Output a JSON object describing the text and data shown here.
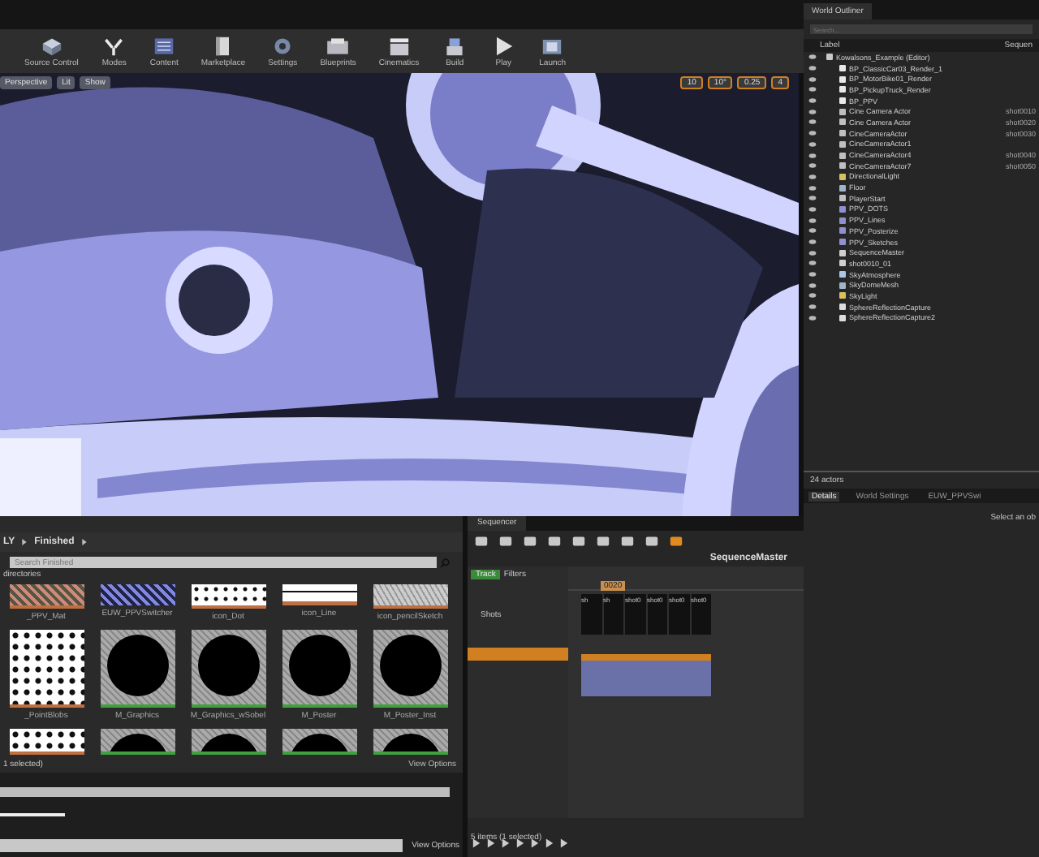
{
  "toolbar": [
    {
      "label": "Source Control",
      "kind": "cube"
    },
    {
      "label": "Modes",
      "kind": "modes"
    },
    {
      "label": "Content",
      "kind": "content"
    },
    {
      "label": "Marketplace",
      "kind": "market"
    },
    {
      "label": "Settings",
      "kind": "settings"
    },
    {
      "label": "Blueprints",
      "kind": "blueprint"
    },
    {
      "label": "Cinematics",
      "kind": "cinema"
    },
    {
      "label": "Build",
      "kind": "build"
    },
    {
      "label": "Play",
      "kind": "play"
    },
    {
      "label": "Launch",
      "kind": "launch"
    }
  ],
  "viewport": {
    "left_buttons": [
      "Perspective",
      "Lit",
      "Show"
    ],
    "right_values": [
      "10",
      "10°",
      "0.25",
      "4"
    ]
  },
  "outliner": {
    "tab": "World Outliner",
    "search": {
      "placeholder": "Search..."
    },
    "columns": [
      "Label",
      "Sequen"
    ],
    "root": {
      "label": "Kowalsons_Example (Editor)",
      "kind": "world",
      "children": [
        {
          "label": "BP_ClassicCar03_Render_1",
          "kind": "actor"
        },
        {
          "label": "BP_MotorBike01_Render",
          "kind": "actor"
        },
        {
          "label": "BP_PickupTruck_Render",
          "kind": "actor"
        },
        {
          "label": "BP_PPV",
          "kind": "actor"
        },
        {
          "label": "Cine Camera Actor",
          "kind": "camera",
          "sequence": "shot0010"
        },
        {
          "label": "Cine Camera Actor",
          "kind": "camera",
          "sequence": "shot0020"
        },
        {
          "label": "CineCameraActor",
          "kind": "camera",
          "sequence": "shot0030"
        },
        {
          "label": "CineCameraActor1",
          "kind": "camera"
        },
        {
          "label": "CineCameraActor4",
          "kind": "camera",
          "sequence": "shot0040"
        },
        {
          "label": "CineCameraActor7",
          "kind": "camera",
          "sequence": "shot0050"
        },
        {
          "label": "DirectionalLight",
          "kind": "light"
        },
        {
          "label": "Floor",
          "kind": "mesh"
        },
        {
          "label": "PlayerStart",
          "kind": "player"
        },
        {
          "label": "PPV_DOTS",
          "kind": "volume"
        },
        {
          "label": "PPV_Lines",
          "kind": "volume"
        },
        {
          "label": "PPV_Posterize",
          "kind": "volume"
        },
        {
          "label": "PPV_Sketches",
          "kind": "volume"
        },
        {
          "label": "SequenceMaster",
          "kind": "sequence"
        },
        {
          "label": "shot0010_01",
          "kind": "sequence"
        },
        {
          "label": "SkyAtmosphere",
          "kind": "sky"
        },
        {
          "label": "SkyDomeMesh",
          "kind": "mesh"
        },
        {
          "label": "SkyLight",
          "kind": "light"
        },
        {
          "label": "SphereReflectionCapture",
          "kind": "reflection"
        },
        {
          "label": "SphereReflectionCapture2",
          "kind": "reflection"
        }
      ]
    },
    "footer": "24 actors"
  },
  "details": {
    "tabs": [
      {
        "label": "Details",
        "selected": true
      },
      {
        "label": "World Settings",
        "selected": false
      },
      {
        "label": "EUW_PPVSwi",
        "selected": false
      }
    ],
    "hint": "Select an ob"
  },
  "content_browser": {
    "breadcrumb": [
      "LY",
      "Finished"
    ],
    "search": {
      "placeholder": "Search Finished"
    },
    "subheader": "directories",
    "assets": [
      {
        "label": "_PPV_Mat",
        "kind": "pink"
      },
      {
        "label": "EUW_PPVSwitcher",
        "kind": "blue"
      },
      {
        "label": "icon_Dot",
        "kind": "dots"
      },
      {
        "label": "icon_Line",
        "kind": "lines"
      },
      {
        "label": "icon_pencilSketch",
        "kind": "sketch"
      },
      {
        "label": "_PointBlobs",
        "kind": "blobs"
      },
      {
        "label": "M_Graphics",
        "kind": "sphere"
      },
      {
        "label": "M_Graphics_wSobel",
        "kind": "sphere"
      },
      {
        "label": "M_Poster",
        "kind": "sphere"
      },
      {
        "label": "M_Poster_Inst",
        "kind": "sphere"
      }
    ],
    "status": "1 selected)",
    "view_options": "View Options"
  },
  "output_log": {
    "view_options": "View Options"
  },
  "sequencer": {
    "tab": "Sequencer",
    "sequence": "SequenceMaster",
    "track_button": "Track",
    "filters": "Filters",
    "time": "0020",
    "shots_label": "Shots",
    "shots": [
      "sh",
      "sh",
      "shot0",
      "shot0",
      "shot0",
      "shot0"
    ],
    "status": "5 items (1 selected)"
  }
}
